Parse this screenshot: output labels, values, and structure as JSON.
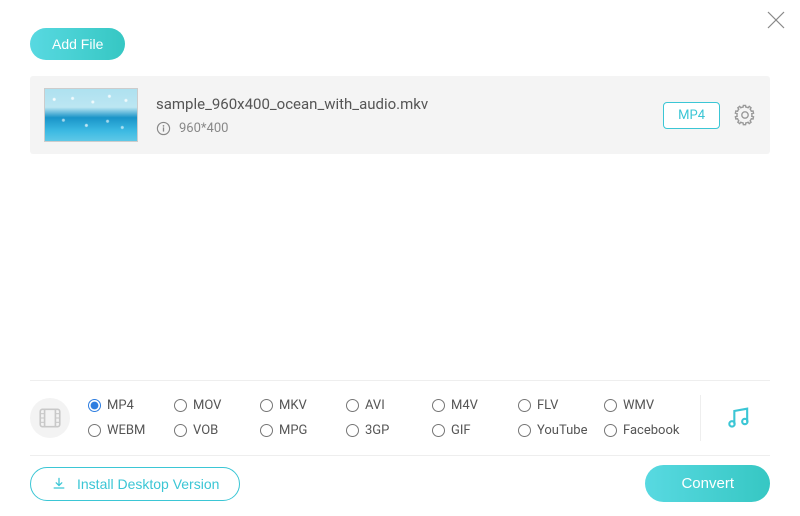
{
  "header": {
    "add_file_label": "Add File"
  },
  "files": [
    {
      "name": "sample_960x400_ocean_with_audio.mkv",
      "dimensions": "960*400",
      "output_format_badge": "MP4"
    }
  ],
  "formats": {
    "options": [
      {
        "id": "mp4",
        "label": "MP4"
      },
      {
        "id": "mov",
        "label": "MOV"
      },
      {
        "id": "mkv",
        "label": "MKV"
      },
      {
        "id": "avi",
        "label": "AVI"
      },
      {
        "id": "m4v",
        "label": "M4V"
      },
      {
        "id": "flv",
        "label": "FLV"
      },
      {
        "id": "wmv",
        "label": "WMV"
      },
      {
        "id": "webm",
        "label": "WEBM"
      },
      {
        "id": "vob",
        "label": "VOB"
      },
      {
        "id": "mpg",
        "label": "MPG"
      },
      {
        "id": "3gp",
        "label": "3GP"
      },
      {
        "id": "gif",
        "label": "GIF"
      },
      {
        "id": "youtube",
        "label": "YouTube"
      },
      {
        "id": "facebook",
        "label": "Facebook"
      }
    ],
    "selected": "mp4"
  },
  "footer": {
    "install_label": "Install Desktop Version",
    "convert_label": "Convert"
  },
  "colors": {
    "accent": "#3bc6d5"
  }
}
